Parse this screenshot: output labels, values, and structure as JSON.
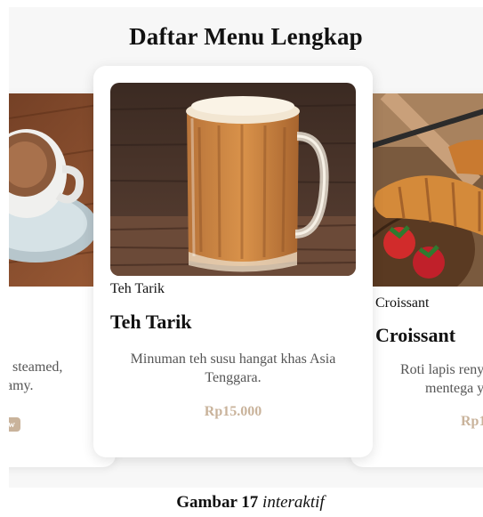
{
  "page": {
    "title": "Daftar Menu Lengkap"
  },
  "cards": {
    "left": {
      "desc_line1": "u steamed,",
      "desc_line2": "amy.",
      "badge": "New"
    },
    "center": {
      "image_caption": "Teh Tarik",
      "name": "Teh Tarik",
      "desc_line1": "Minuman teh susu hangat khas Asia",
      "desc_line2": "Tenggara.",
      "price": "Rp15.000"
    },
    "right": {
      "image_caption": "Croissant",
      "name": "Croissant",
      "desc_line1": "Roti lapis reny",
      "desc_line2": "mentega y",
      "price": "Rp1"
    }
  },
  "caption": {
    "label": "Gambar 17",
    "suffix": "interaktif"
  },
  "colors": {
    "accent": "#c9b39b"
  }
}
